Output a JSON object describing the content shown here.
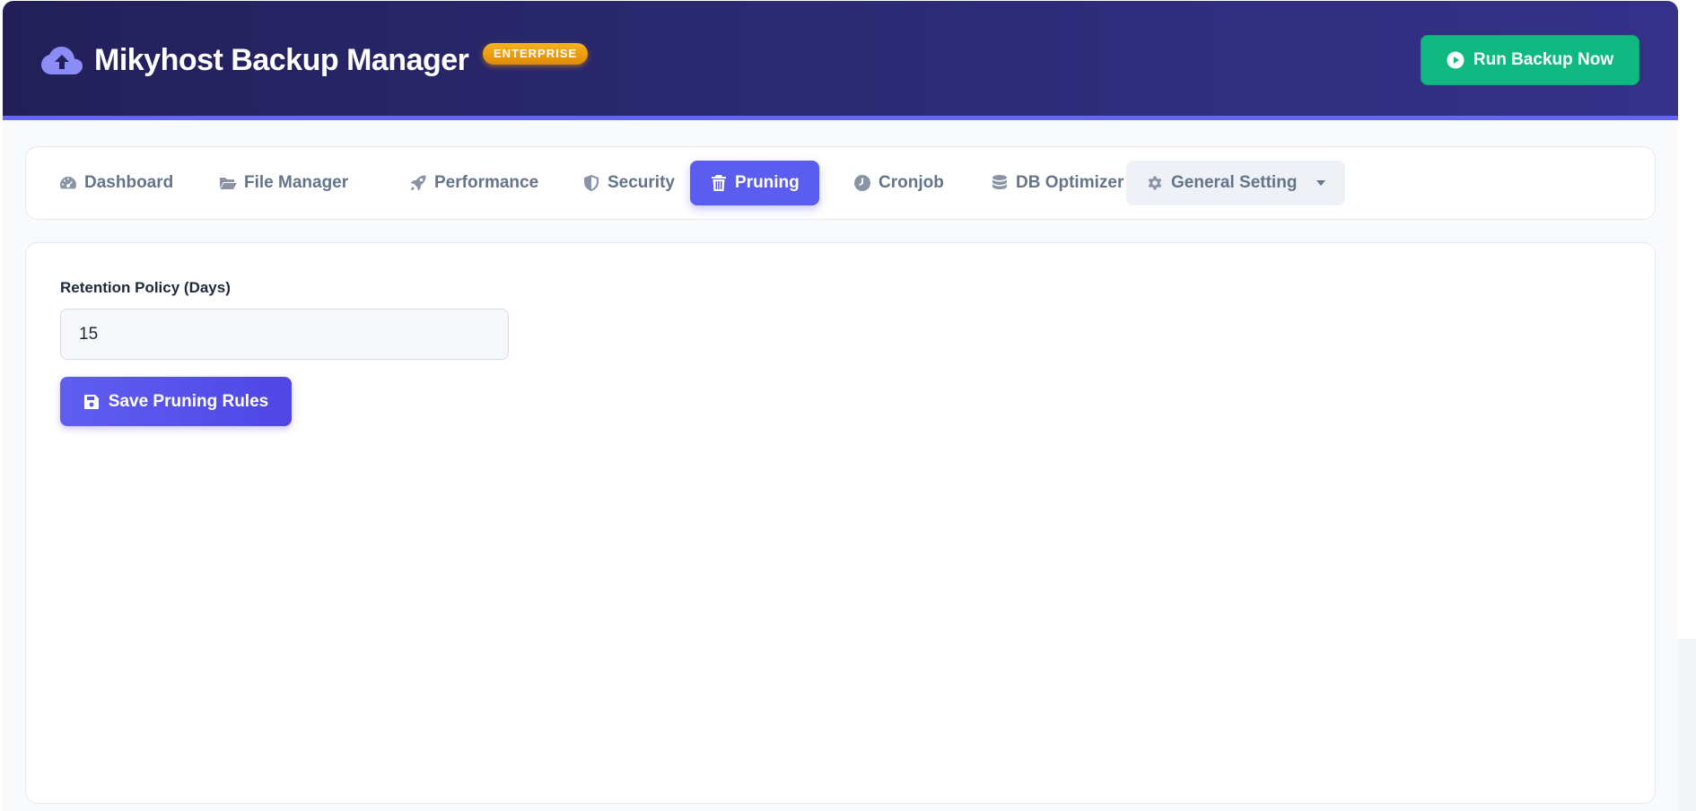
{
  "header": {
    "title": "Mikyhost Backup Manager",
    "badge": "ENTERPRISE",
    "run_button": "Run Backup Now",
    "icons": {
      "brand": "cloud-upload-icon",
      "run": "play-circle-icon"
    }
  },
  "colors": {
    "header_start": "#221f58",
    "header_end": "#353189",
    "accent": "#6366f1",
    "active_tab": "#5b5cf0",
    "run_button": "#10b981",
    "badge": "#f59e0b"
  },
  "tabs": [
    {
      "label": "Dashboard",
      "icon": "gauge-icon"
    },
    {
      "label": "File Manager",
      "icon": "folder-open-icon"
    },
    {
      "label": "Performance",
      "icon": "rocket-icon"
    },
    {
      "label": "Security",
      "icon": "shield-icon"
    },
    {
      "label": "Pruning",
      "icon": "trash-icon",
      "active": true
    },
    {
      "label": "Cronjob",
      "icon": "clock-icon"
    },
    {
      "label": "DB Optimizer",
      "icon": "database-icon"
    },
    {
      "label": "General Setting",
      "icon": "gear-icon",
      "dropdown": true
    }
  ],
  "pruning": {
    "retention_label": "Retention Policy (Days)",
    "retention_value": "15",
    "save_button": "Save Pruning Rules",
    "save_icon": "floppy-disk-icon"
  }
}
